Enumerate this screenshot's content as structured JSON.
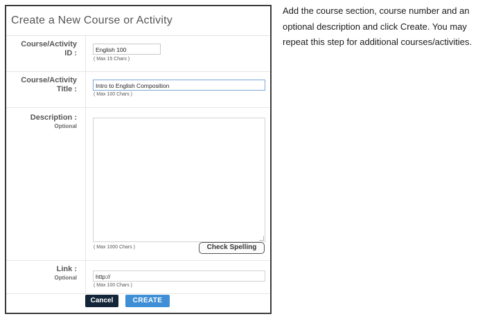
{
  "dialog": {
    "title": "Create a New Course or Activity",
    "fields": {
      "id": {
        "label_line1": "Course/Activity",
        "label_line2": "ID :",
        "value": "English 100",
        "hint": "( Max 15 Chars )"
      },
      "title": {
        "label_line1": "Course/Activity",
        "label_line2": "Title :",
        "value": "Intro to English Composition",
        "hint": "( Max 100 Chars )"
      },
      "description": {
        "label": "Description :",
        "sublabel": "Optional",
        "value": "",
        "hint": "( Max 1000 Chars )",
        "check_spelling_label": "Check Spelling"
      },
      "link": {
        "label": "Link :",
        "sublabel": "Optional",
        "value": "http://",
        "hint": "( Max 100 Chars )"
      }
    },
    "buttons": {
      "cancel": "Cancel",
      "create": "CREATE"
    }
  },
  "instructions": "Add the course section, course number and an optional description and click Create. You may repeat this step for additional courses/activities.",
  "colors": {
    "cancel_bg": "#132538",
    "create_bg": "#3f8fd6",
    "focus_border": "#7aa7d8"
  }
}
